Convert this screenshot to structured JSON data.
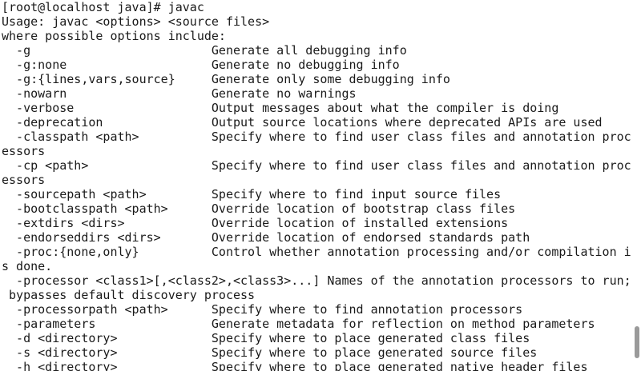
{
  "terminal": {
    "lines": [
      "[root@localhost java]# javac",
      "Usage: javac <options> <source files>",
      "where possible options include:",
      "  -g                         Generate all debugging info",
      "  -g:none                    Generate no debugging info",
      "  -g:{lines,vars,source}     Generate only some debugging info",
      "  -nowarn                    Generate no warnings",
      "  -verbose                   Output messages about what the compiler is doing",
      "  -deprecation               Output source locations where deprecated APIs are used",
      "  -classpath <path>          Specify where to find user class files and annotation proc",
      "essors",
      "  -cp <path>                 Specify where to find user class files and annotation proc",
      "essors",
      "  -sourcepath <path>         Specify where to find input source files",
      "  -bootclasspath <path>      Override location of bootstrap class files",
      "  -extdirs <dirs>            Override location of installed extensions",
      "  -endorseddirs <dirs>       Override location of endorsed standards path",
      "  -proc:{none,only}          Control whether annotation processing and/or compilation i",
      "s done.",
      "  -processor <class1>[,<class2>,<class3>...] Names of the annotation processors to run;",
      " bypasses default discovery process",
      "  -processorpath <path>      Specify where to find annotation processors",
      "  -parameters                Generate metadata for reflection on method parameters",
      "  -d <directory>             Specify where to place generated class files",
      "  -s <directory>             Specify where to place generated source files",
      "  -h <directory>             Specify where to place generated native header files"
    ]
  },
  "colors": {
    "background": "#ffffff",
    "text": "#1a1a1a",
    "scroll_thumb": "#9a9a9a"
  }
}
